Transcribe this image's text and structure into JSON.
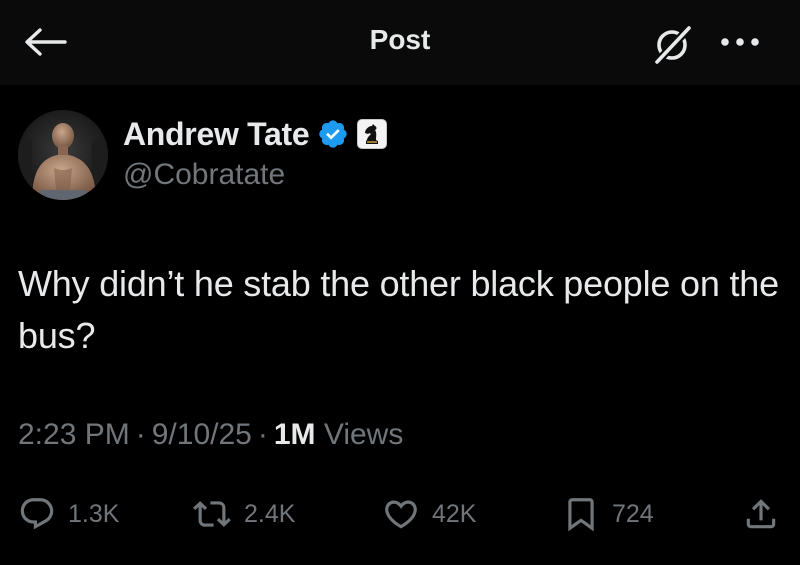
{
  "header": {
    "title": "Post",
    "back_icon": "arrow-left-icon",
    "grok_icon": "grok-icon",
    "more_icon": "more-horizontal-icon"
  },
  "author": {
    "display_name": "Andrew Tate",
    "handle": "@Cobratate",
    "verified_icon": "verified-badge-icon",
    "affiliate_icon": "chess-knight-icon",
    "verified_color": "#1d9bf0"
  },
  "tweet": {
    "text": "Why didn’t he stab the other black people on the bus?"
  },
  "meta": {
    "time": "2:23 PM",
    "sep1": "·",
    "date": "9/10/25",
    "sep2": "·",
    "views_count": "1M",
    "views_label": "Views"
  },
  "actions": {
    "replies": "1.3K",
    "reposts": "2.4K",
    "likes": "42K",
    "bookmarks": "724"
  },
  "colors": {
    "background": "#000000",
    "text_primary": "#e7e9ea",
    "text_secondary": "#71767b"
  }
}
